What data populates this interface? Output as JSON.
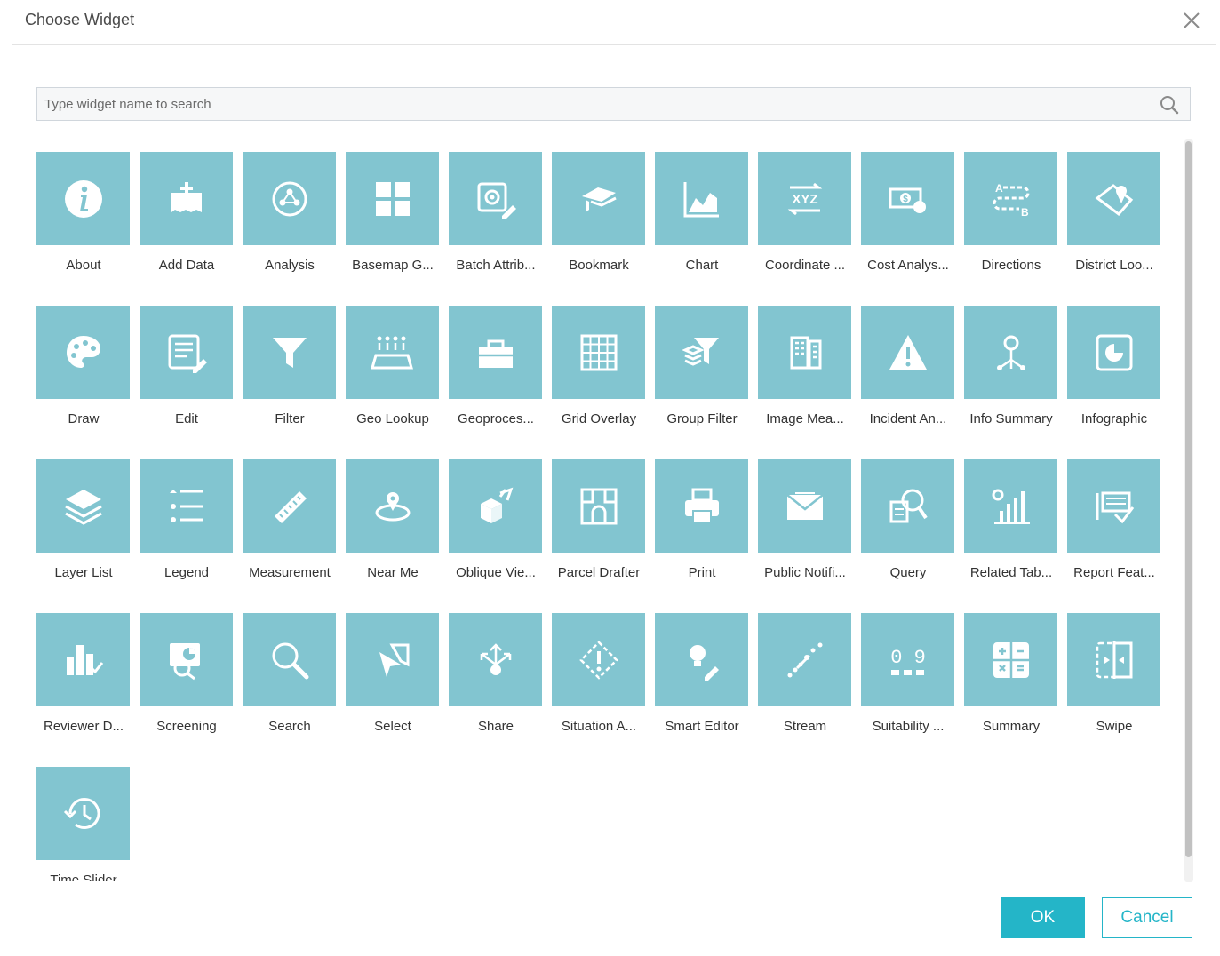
{
  "dialog": {
    "title": "Choose Widget",
    "search_placeholder": "Type widget name to search",
    "ok_label": "OK",
    "cancel_label": "Cancel"
  },
  "colors": {
    "tile": "#82c5d0",
    "accent": "#24b5c8"
  },
  "widgets": [
    {
      "label": "About",
      "icon": "info-icon"
    },
    {
      "label": "Add Data",
      "icon": "add-data-icon"
    },
    {
      "label": "Analysis",
      "icon": "analysis-icon"
    },
    {
      "label": "Basemap G...",
      "icon": "basemap-gallery-icon"
    },
    {
      "label": "Batch Attrib...",
      "icon": "batch-attribute-icon"
    },
    {
      "label": "Bookmark",
      "icon": "bookmark-icon"
    },
    {
      "label": "Chart",
      "icon": "chart-icon"
    },
    {
      "label": "Coordinate ...",
      "icon": "coordinate-icon"
    },
    {
      "label": "Cost Analys...",
      "icon": "cost-analysis-icon"
    },
    {
      "label": "Directions",
      "icon": "directions-icon"
    },
    {
      "label": "District Loo...",
      "icon": "district-lookup-icon"
    },
    {
      "label": "Draw",
      "icon": "palette-icon"
    },
    {
      "label": "Edit",
      "icon": "edit-icon"
    },
    {
      "label": "Filter",
      "icon": "filter-icon"
    },
    {
      "label": "Geo Lookup",
      "icon": "geo-lookup-icon"
    },
    {
      "label": "Geoproces...",
      "icon": "toolbox-icon"
    },
    {
      "label": "Grid Overlay",
      "icon": "grid-overlay-icon"
    },
    {
      "label": "Group Filter",
      "icon": "group-filter-icon"
    },
    {
      "label": "Image Mea...",
      "icon": "image-measurement-icon"
    },
    {
      "label": "Incident An...",
      "icon": "warning-icon"
    },
    {
      "label": "Info Summary",
      "icon": "info-summary-icon"
    },
    {
      "label": "Infographic",
      "icon": "infographic-icon"
    },
    {
      "label": "Layer List",
      "icon": "layers-icon"
    },
    {
      "label": "Legend",
      "icon": "legend-icon"
    },
    {
      "label": "Measurement",
      "icon": "ruler-icon"
    },
    {
      "label": "Near Me",
      "icon": "near-me-icon"
    },
    {
      "label": "Oblique Vie...",
      "icon": "oblique-viewer-icon"
    },
    {
      "label": "Parcel Drafter",
      "icon": "parcel-drafter-icon"
    },
    {
      "label": "Print",
      "icon": "printer-icon"
    },
    {
      "label": "Public Notifi...",
      "icon": "envelope-icon"
    },
    {
      "label": "Query",
      "icon": "query-icon"
    },
    {
      "label": "Related Tab...",
      "icon": "related-table-icon"
    },
    {
      "label": "Report Feat...",
      "icon": "report-feature-icon"
    },
    {
      "label": "Reviewer D...",
      "icon": "reviewer-dashboard-icon"
    },
    {
      "label": "Screening",
      "icon": "screening-icon"
    },
    {
      "label": "Search",
      "icon": "search-icon"
    },
    {
      "label": "Select",
      "icon": "select-icon"
    },
    {
      "label": "Share",
      "icon": "share-icon"
    },
    {
      "label": "Situation A...",
      "icon": "situation-awareness-icon"
    },
    {
      "label": "Smart Editor",
      "icon": "smart-editor-icon"
    },
    {
      "label": "Stream",
      "icon": "stream-icon"
    },
    {
      "label": "Suitability ...",
      "icon": "suitability-icon"
    },
    {
      "label": "Summary",
      "icon": "calculator-icon"
    },
    {
      "label": "Swipe",
      "icon": "swipe-icon"
    },
    {
      "label": "Time Slider",
      "icon": "history-icon"
    }
  ]
}
